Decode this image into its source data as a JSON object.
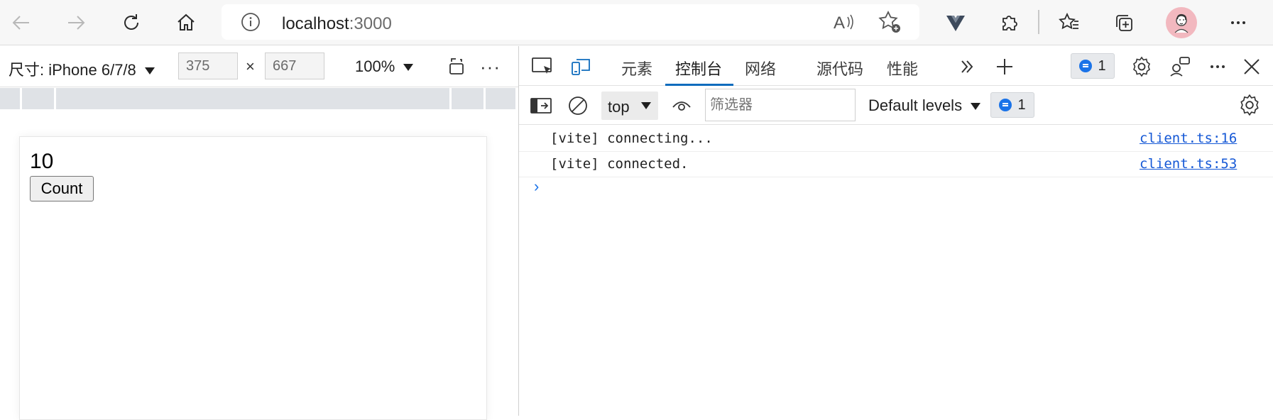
{
  "browser": {
    "url_host": "localhost",
    "url_port": ":3000"
  },
  "device_toolbar": {
    "dimensions_label": "尺寸: iPhone 6/7/8",
    "width": "375",
    "height": "667",
    "times": "×",
    "zoom": "100%",
    "more": "···"
  },
  "page": {
    "count_value": "10",
    "count_button": "Count"
  },
  "devtools": {
    "tabs": [
      {
        "label": "元素"
      },
      {
        "label": "控制台"
      },
      {
        "label": "网络"
      },
      {
        "label": "源代码"
      },
      {
        "label": "性能"
      }
    ],
    "active_tab": "控制台",
    "issues_count": "1",
    "more": "···"
  },
  "console": {
    "context": "top",
    "filter_placeholder": "筛选器",
    "levels": "Default levels",
    "message_count": "1",
    "logs": [
      {
        "message": "[vite] connecting...",
        "source": "client.ts:16"
      },
      {
        "message": "[vite] connected.",
        "source": "client.ts:53"
      }
    ],
    "prompt": "›"
  },
  "colors": {
    "accent": "#0f6cbd",
    "link": "#1558d6",
    "avatar_bg": "#f2b8bf"
  }
}
